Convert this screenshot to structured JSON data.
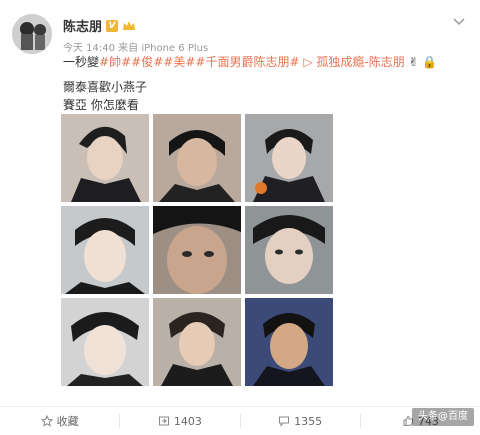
{
  "post": {
    "author": "陈志朋",
    "meta": "今天 14:40 来自 iPhone 6 Plus",
    "line1_prefix": "一秒變",
    "tags": [
      "#帥#",
      "#俊#",
      "#美#",
      "#千面男爵陈志朋#"
    ],
    "link_text": "▷ 孤独成瘾-陈志朋",
    "line1_suffix": "✌ 🔒",
    "line2": "爾泰喜歡小燕子",
    "line3": "賽亞 你怎麼看"
  },
  "photos": [
    {
      "label": "photo-1"
    },
    {
      "label": "photo-2"
    },
    {
      "label": "photo-3"
    },
    {
      "label": "photo-4"
    },
    {
      "label": "photo-5"
    },
    {
      "label": "photo-6"
    },
    {
      "label": "photo-7"
    },
    {
      "label": "photo-8"
    },
    {
      "label": "photo-9"
    }
  ],
  "footer": {
    "favorite": "收藏",
    "repost": "1403",
    "comment": "1355",
    "like": "743"
  },
  "watermark": "头条@百度"
}
